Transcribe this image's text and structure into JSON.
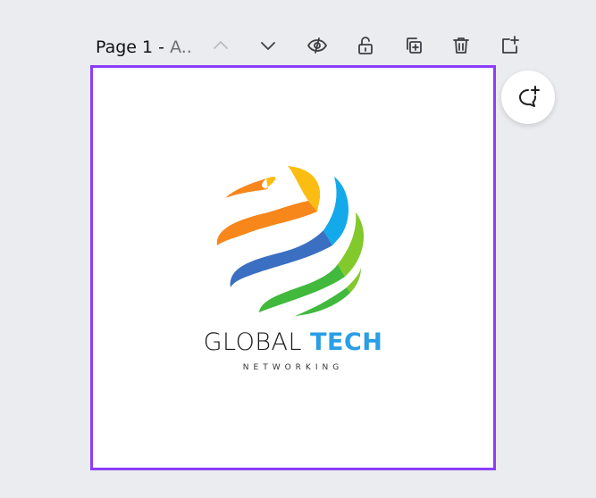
{
  "toolbar": {
    "page_label": "Page 1 - ",
    "page_title_truncated": "A..",
    "icons": [
      "chevron-up-icon",
      "chevron-down-icon",
      "eye-hidden-icon",
      "unlock-icon",
      "duplicate-icon",
      "trash-icon",
      "add-page-icon"
    ]
  },
  "comment": {
    "icon": "add-comment-icon"
  },
  "logo": {
    "word1": "GLOBAL",
    "word2": "TECH",
    "tagline": "NETWORKING",
    "colors": {
      "orange": "#f7861b",
      "yellow": "#fbbd11",
      "blue": "#3a6fc1",
      "lightblue": "#14a9ea",
      "green": "#40b93c",
      "lightgreen": "#82c92c",
      "accent": "#2a9ee6",
      "selection": "#8b3dff"
    }
  }
}
